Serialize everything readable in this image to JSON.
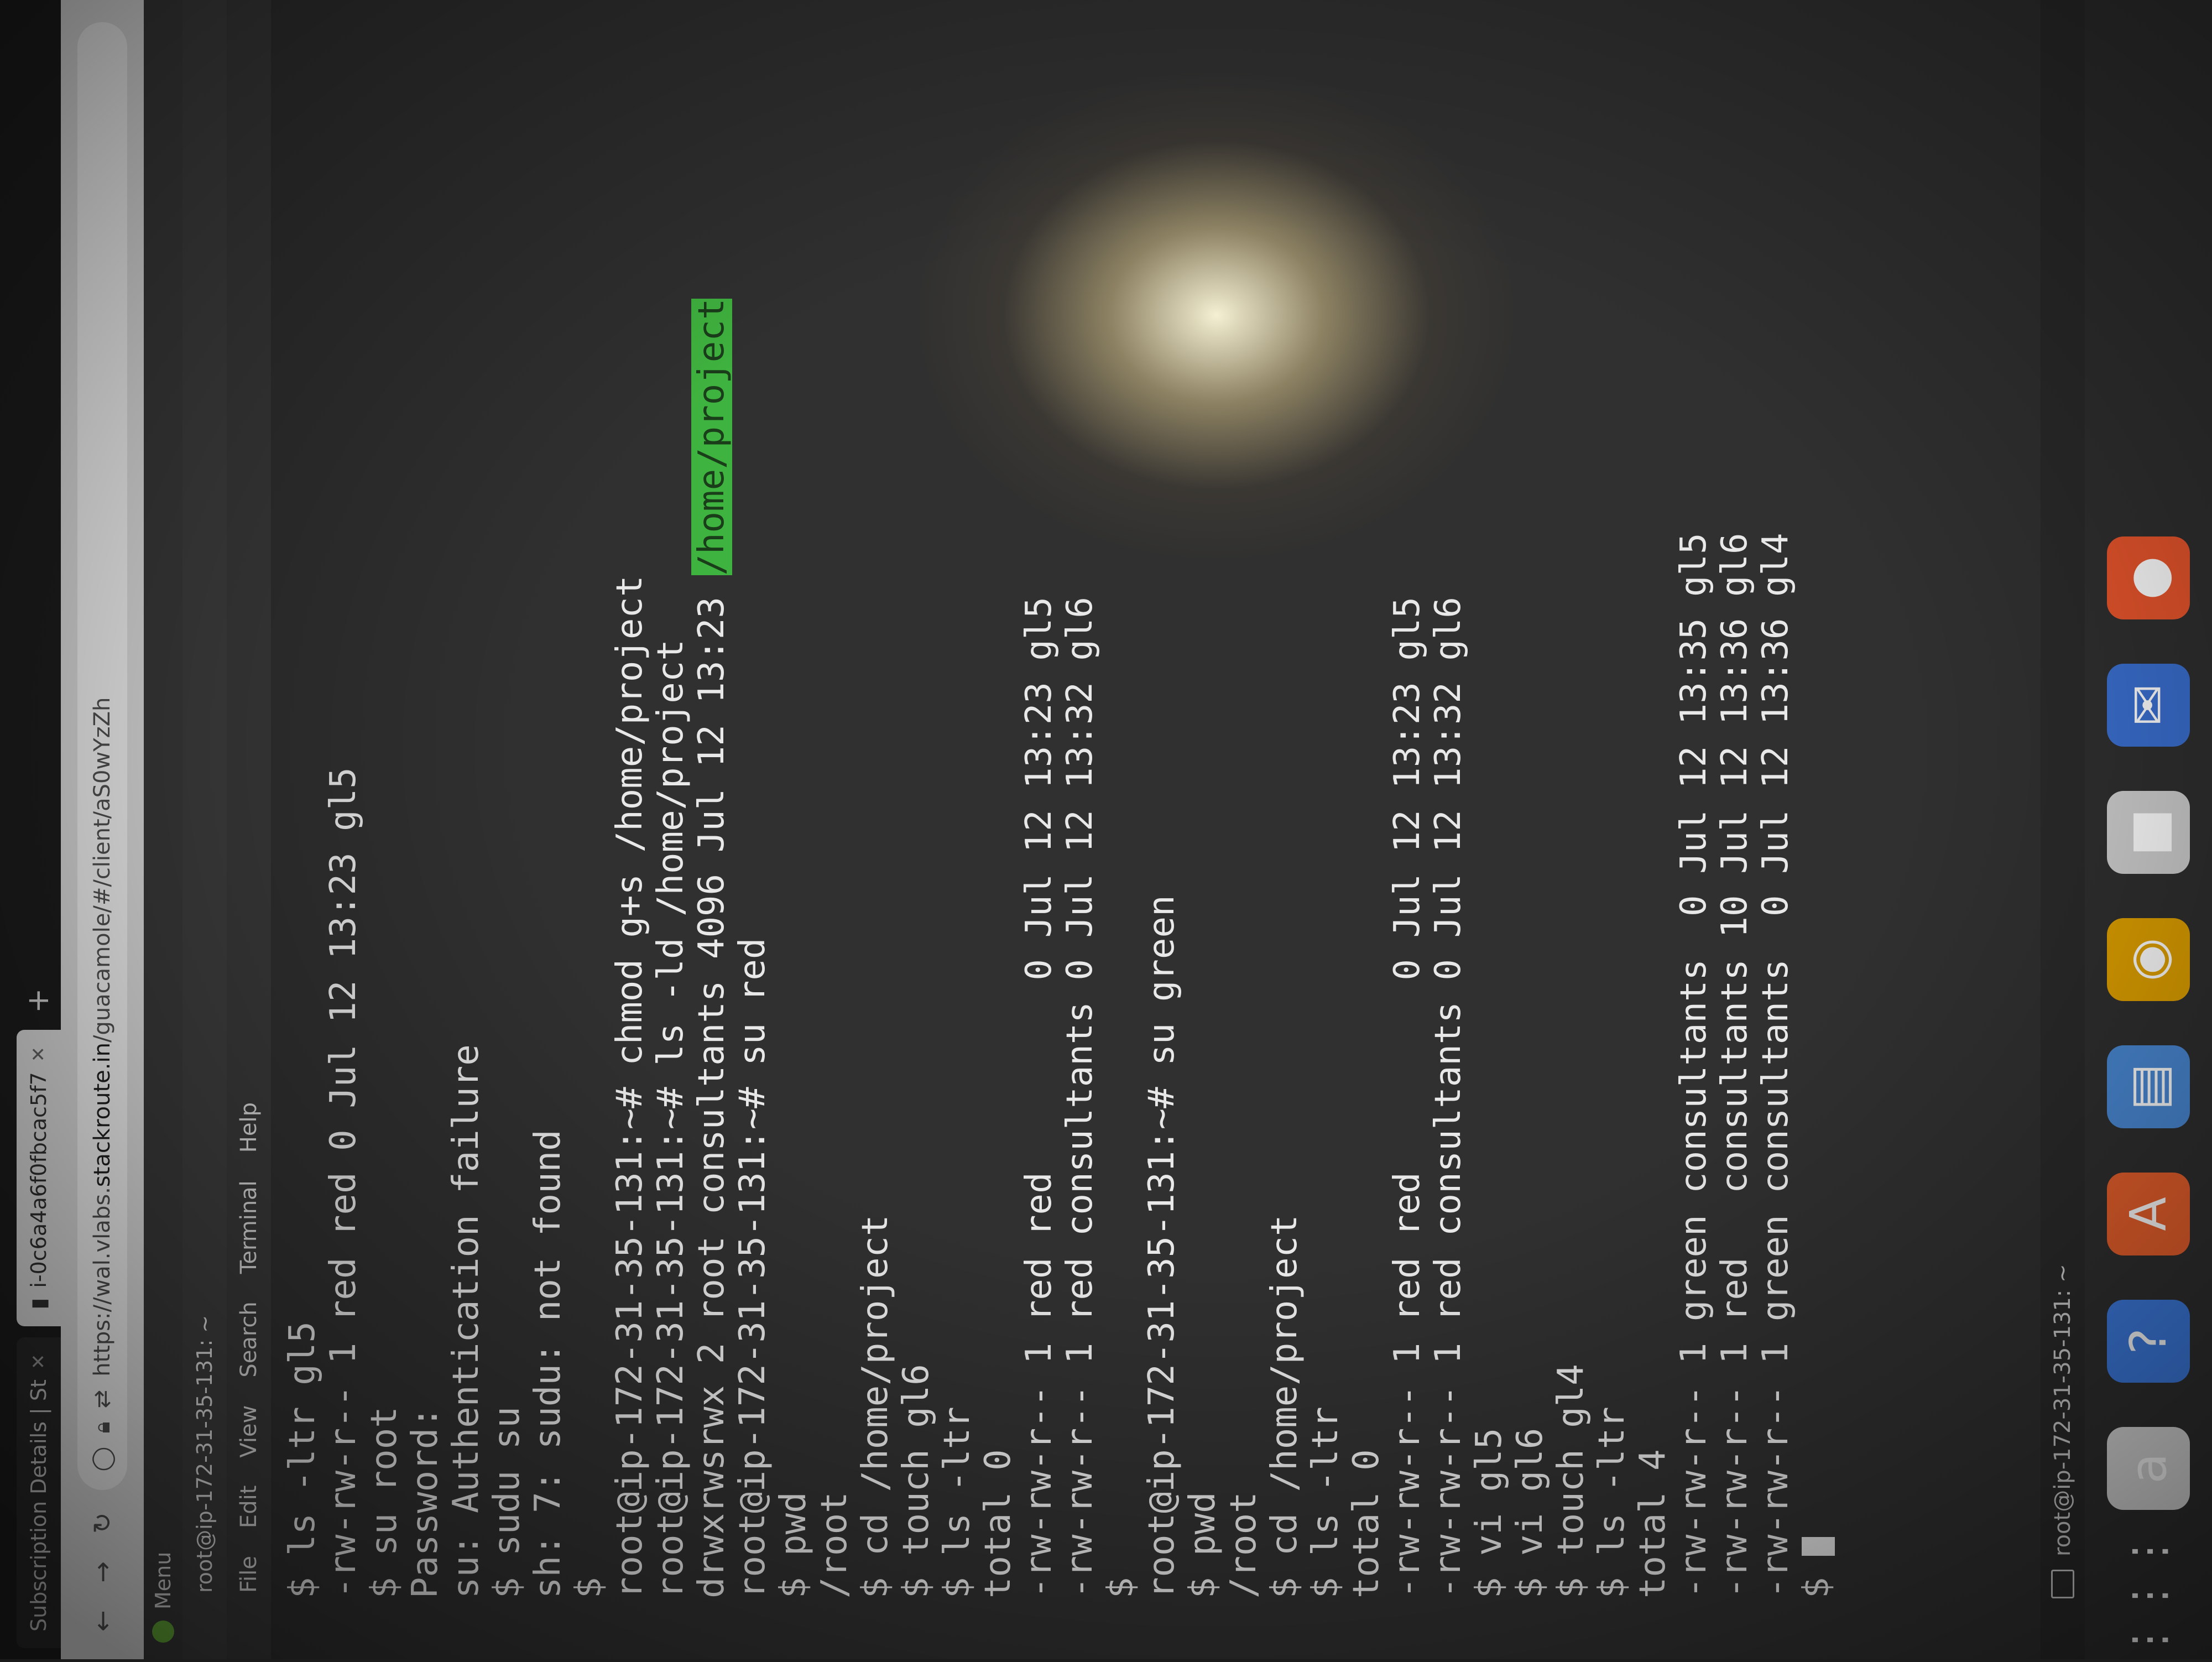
{
  "browser": {
    "tabs": [
      {
        "label": "Subscription Details | St",
        "active": false
      },
      {
        "label": "i-0c6a4a6f0fbcac5f7",
        "active": true
      }
    ],
    "url_prefix": "https://wal.vlabs.",
    "url_host": "stackroute.in",
    "url_path": "/guacamole/#/client/aS0wYzZh",
    "new_tab_label": "+"
  },
  "desktop": {
    "menu_label": "Menu",
    "window_title": "root@ip-172-31-35-131: ~",
    "taskbar_title": "root@ip-172-31-35-131: ~"
  },
  "terminal": {
    "menu": [
      "File",
      "Edit",
      "View",
      "Search",
      "Terminal",
      "Help"
    ],
    "lines": [
      "$ ls -ltr gl5",
      "-rw-rw-r-- 1 red red 0 Jul 12 13:23 gl5",
      "$ su root",
      "Password:",
      "su: Authentication failure",
      "$ sudu su",
      "sh: 7: sudu: not found",
      "$",
      "root@ip-172-31-35-131:~# chmod g+s /home/project",
      "root@ip-172-31-35-131:~# ls -ld /home/project",
      "drwxrwsrwx 2 root consultants 4096 Jul 12 13:23 ",
      "root@ip-172-31-35-131:~# su red",
      "$ pwd",
      "/root",
      "$ cd /home/project",
      "$ touch gl6",
      "$ ls -ltr",
      "total 0",
      "-rw-rw-r-- 1 red red         0 Jul 12 13:23 gl5",
      "-rw-rw-r-- 1 red consultants 0 Jul 12 13:32 gl6",
      "$",
      "root@ip-172-31-35-131:~# su green",
      "$ pwd",
      "/root",
      "$ cd /home/project",
      "$ ls -ltr",
      "total 0",
      "-rw-rw-r-- 1 red red         0 Jul 12 13:23 gl5",
      "-rw-rw-r-- 1 red consultants 0 Jul 12 13:32 gl6",
      "$ vi gl5",
      "$ vi gl6",
      "$ touch gl4",
      "$ ls -ltr",
      "total 4",
      "-rw-rw-r-- 1 green consultants  0 Jul 12 13:35 gl5",
      "-rw-rw-r-- 1 red   consultants 10 Jul 12 13:36 gl6",
      "-rw-rw-r-- 1 green consultants  0 Jul 12 13:36 gl4",
      "$ "
    ],
    "highlighted_path": "/home/project",
    "highlight_color": "#3fb33f"
  },
  "launcher_icons": [
    {
      "name": "firefox-icon",
      "color": "#e8552c",
      "glyph": "●"
    },
    {
      "name": "thunderbird-icon",
      "color": "#3a6fd0",
      "glyph": "✉"
    },
    {
      "name": "files-icon",
      "color": "#cfcfcf",
      "glyph": "■"
    },
    {
      "name": "rhythmbox-icon",
      "color": "#e0a100",
      "glyph": "◉"
    },
    {
      "name": "writer-icon",
      "color": "#4a8ad6",
      "glyph": "▤"
    },
    {
      "name": "software-icon",
      "color": "#e8602c",
      "glyph": "A"
    },
    {
      "name": "help-icon",
      "color": "#3d7be0",
      "glyph": "?"
    },
    {
      "name": "amazon-icon",
      "color": "#dcdcdc",
      "glyph": "a"
    }
  ]
}
